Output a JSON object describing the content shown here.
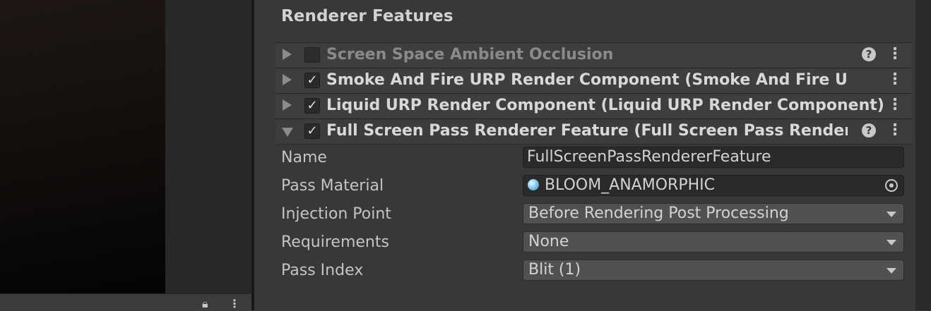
{
  "inspector": {
    "section_title": "Renderer Features",
    "features": [
      {
        "label": "Screen Space Ambient Occlusion",
        "enabled": false,
        "expanded": false,
        "has_help": true
      },
      {
        "label": "Smoke And Fire URP Render Component (Smoke And Fire URP R",
        "enabled": true,
        "expanded": false,
        "has_help": false
      },
      {
        "label": "Liquid URP Render Component (Liquid URP Render Component)",
        "enabled": true,
        "expanded": false,
        "has_help": false
      },
      {
        "label": "Full Screen Pass Renderer Feature (Full Screen Pass Renderer F",
        "enabled": true,
        "expanded": true,
        "has_help": true
      }
    ],
    "properties": [
      {
        "label": "Name",
        "value": "FullScreenPassRendererFeature",
        "type": "text"
      },
      {
        "label": "Pass Material",
        "value": "BLOOM_ANAMORPHIC",
        "type": "object"
      },
      {
        "label": "Injection Point",
        "value": "Before Rendering Post Processing",
        "type": "dropdown"
      },
      {
        "label": "Requirements",
        "value": "None",
        "type": "dropdown"
      },
      {
        "label": "Pass Index",
        "value": "Blit (1)",
        "type": "dropdown"
      }
    ]
  },
  "icons": {
    "foldout": "foldout-arrow-icon",
    "checkmark": "checkmark-icon",
    "help": "help-icon",
    "menu": "kebab-menu-icon",
    "material": "material-sphere-icon",
    "picker": "object-picker-icon",
    "dropdown": "dropdown-caret-icon",
    "lock": "lock-icon"
  }
}
